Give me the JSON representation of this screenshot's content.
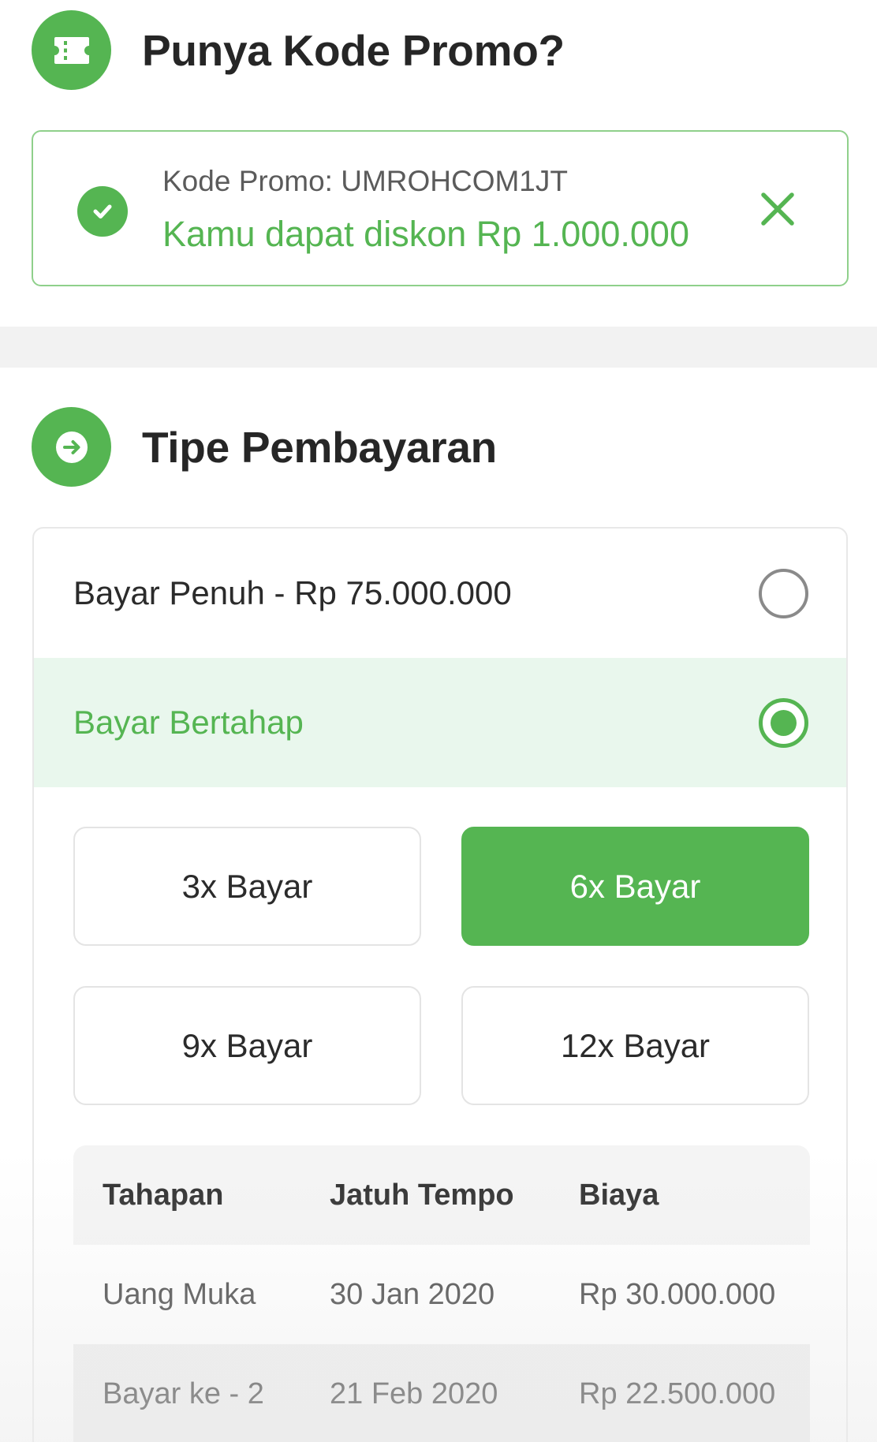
{
  "promo": {
    "title": "Punya Kode Promo?",
    "icon": "ticket-icon",
    "code_line": "Kode Promo: UMROHCOM1JT",
    "discount_text": "Kamu dapat diskon Rp 1.000.000",
    "status_icon": "check-circle-icon",
    "close_icon": "close-icon"
  },
  "payment": {
    "title": "Tipe Pembayaran",
    "icon": "arrow-right-circle-icon",
    "options": [
      {
        "label": "Bayar Penuh - Rp 75.000.000",
        "selected": false
      },
      {
        "label": "Bayar Bertahap",
        "selected": true
      }
    ],
    "plans": [
      {
        "label": "3x Bayar",
        "active": false
      },
      {
        "label": "6x Bayar",
        "active": true
      },
      {
        "label": "9x Bayar",
        "active": false
      },
      {
        "label": "12x Bayar",
        "active": false
      }
    ],
    "schedule": {
      "headers": [
        "Tahapan",
        "Jatuh Tempo",
        "Biaya"
      ],
      "rows": [
        [
          "Uang Muka",
          "30 Jan 2020",
          "Rp 30.000.000"
        ],
        [
          "Bayar ke - 2",
          "21 Feb 2020",
          "Rp 22.500.000"
        ]
      ]
    }
  },
  "colors": {
    "brand_green": "#55b552",
    "selected_row_bg": "#e9f7ed",
    "promo_border": "#8fd08b"
  }
}
